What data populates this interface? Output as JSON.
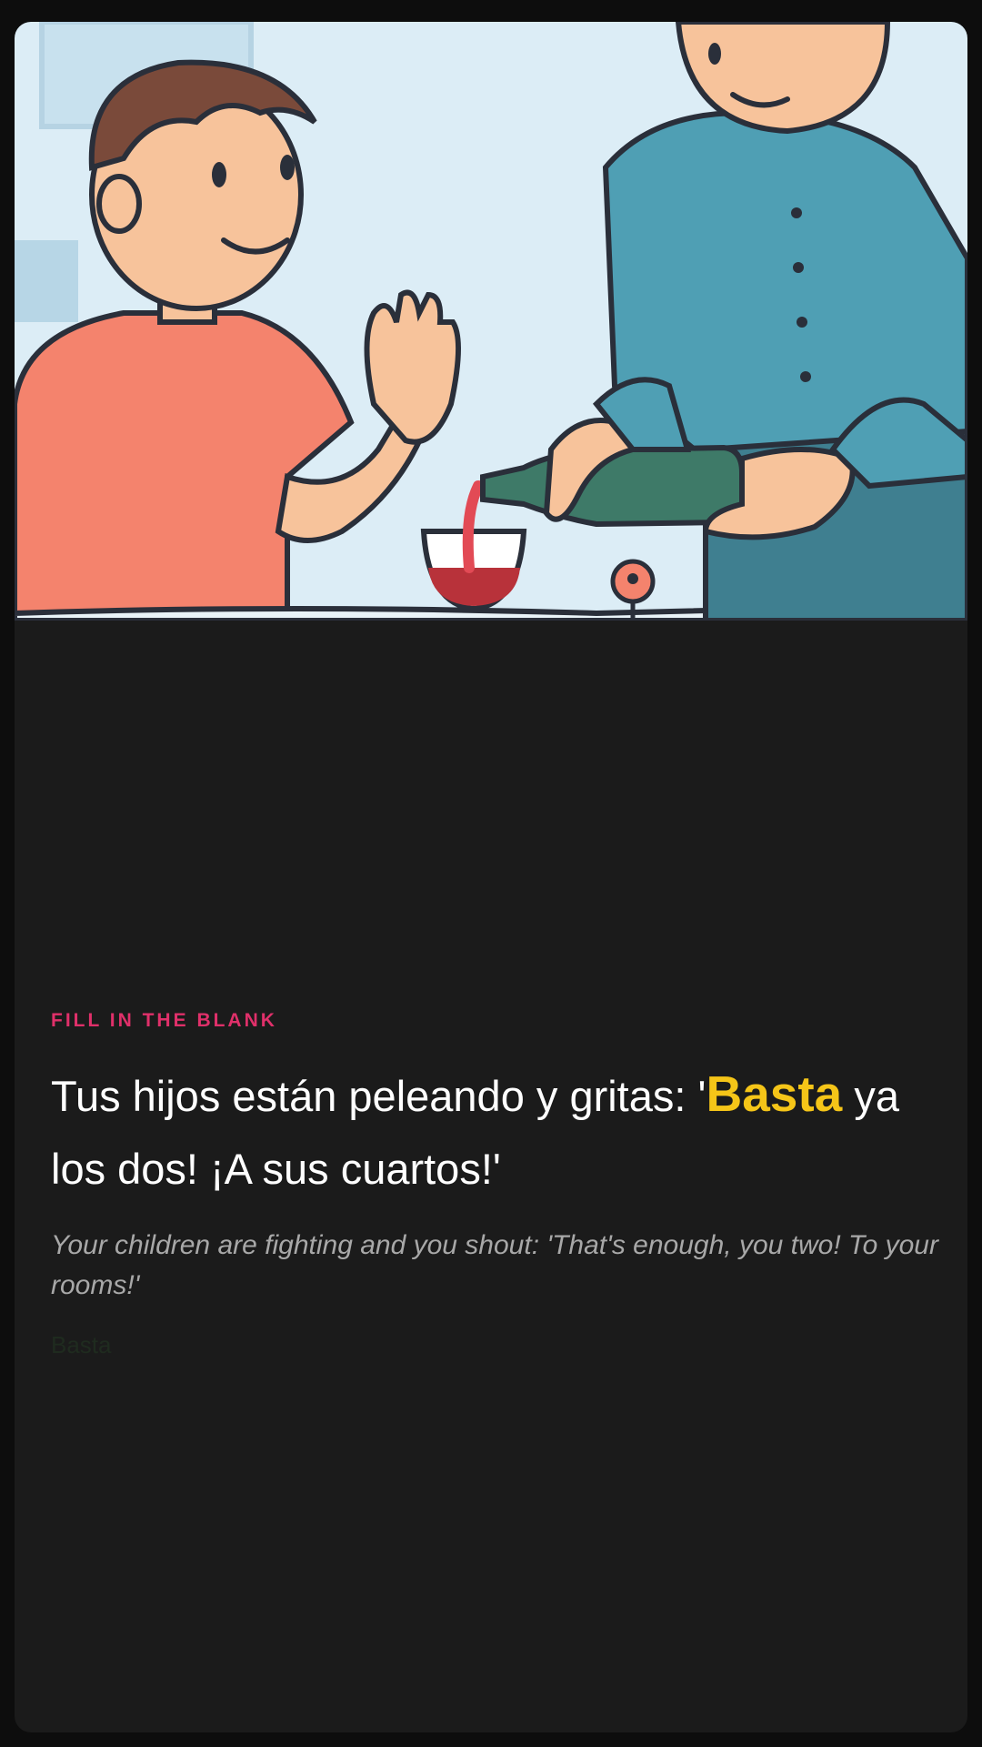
{
  "exercise": {
    "kicker": "FILL IN THE BLANK",
    "sentence_before": "Tus hijos están peleando y gritas: '",
    "answer": "Basta",
    "sentence_after": " ya los dos! ¡A sus cuartos!'",
    "translation": "Your children are fighting and you shout: 'That's enough, you two! To your rooms!'",
    "answer_faint": "Basta"
  },
  "illustration": {
    "description_icon": "dinner-refusal-illustration",
    "colors": {
      "background": "#dcedf6",
      "shirt_left": "#f4836d",
      "shirt_right": "#4f9fb4",
      "bottle": "#3e7a68",
      "wine": "#b8323a",
      "skin": "#f7c39b",
      "hair": "#7a4a3a",
      "outline": "#2a2f3a"
    }
  },
  "theme": {
    "card_bg": "#1b1b1b",
    "accent_pink": "#e0306a",
    "accent_yellow": "#f5c518"
  }
}
